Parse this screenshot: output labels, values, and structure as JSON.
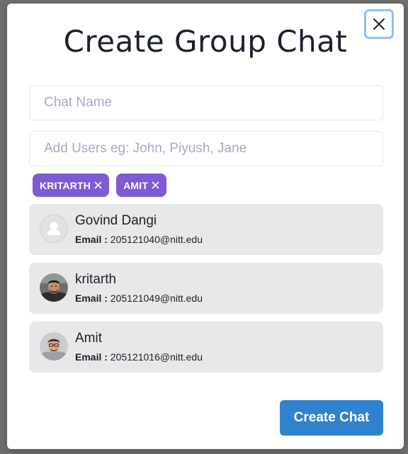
{
  "modal": {
    "title": "Create Group Chat",
    "close_icon": "close-icon"
  },
  "form": {
    "chat_name": {
      "value": "",
      "placeholder": "Chat Name"
    },
    "add_users": {
      "value": "",
      "placeholder": "Add Users eg: John, Piyush, Jane"
    }
  },
  "selected_users": [
    {
      "label": "KRITARTH",
      "remove_icon": "close-icon"
    },
    {
      "label": "AMIT",
      "remove_icon": "close-icon"
    }
  ],
  "search_results": [
    {
      "name": "Govind Dangi",
      "email_label": "Email :",
      "email": "205121040@nitt.edu",
      "avatar": "default-avatar-icon"
    },
    {
      "name": "kritarth",
      "email_label": "Email :",
      "email": "205121049@nitt.edu",
      "avatar": "user-photo"
    },
    {
      "name": "Amit",
      "email_label": "Email :",
      "email": "205121016@nitt.edu",
      "avatar": "user-photo"
    }
  ],
  "actions": {
    "create_label": "Create Chat"
  },
  "colors": {
    "badge": "#805ad5",
    "primary_button": "#3182ce",
    "list_item_bg": "#e8e8e8",
    "close_focus_ring": "#90c2f0"
  }
}
